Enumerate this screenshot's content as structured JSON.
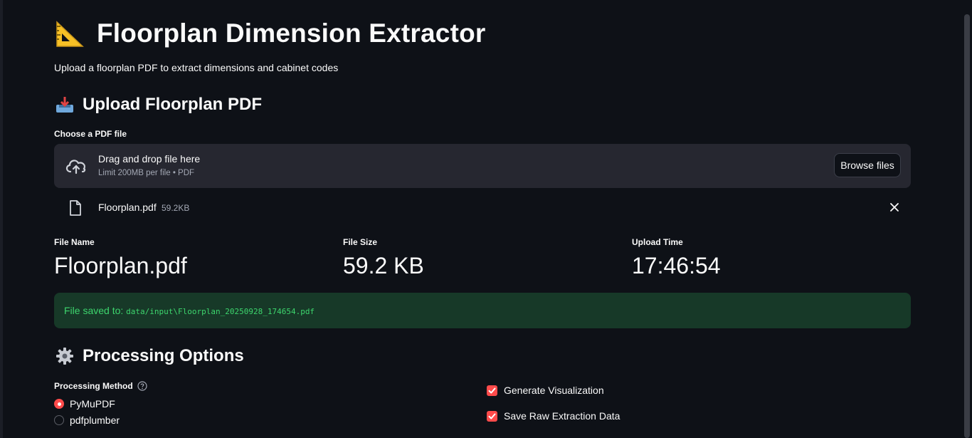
{
  "header": {
    "title_icon": "triangular-ruler-icon",
    "title": "Floorplan Dimension Extractor",
    "subtitle": "Upload a floorplan PDF to extract dimensions and cabinet codes"
  },
  "upload": {
    "section_icon": "inbox-tray-icon",
    "heading": "Upload Floorplan PDF",
    "field_label": "Choose a PDF file",
    "dropzone_title": "Drag and drop file here",
    "dropzone_limit": "Limit 200MB per file • PDF",
    "browse_label": "Browse files",
    "uploaded_file": {
      "name": "Floorplan.pdf",
      "size": "59.2KB"
    }
  },
  "metrics": [
    {
      "label": "File Name",
      "value": "Floorplan.pdf"
    },
    {
      "label": "File Size",
      "value": "59.2 KB"
    },
    {
      "label": "Upload Time",
      "value": "17:46:54"
    }
  ],
  "success": {
    "prefix": "File saved to:",
    "path": "data/input\\Floorplan_20250928_174654.pdf"
  },
  "processing": {
    "section_icon": "gear-icon",
    "heading": "Processing Options",
    "method_label": "Processing Method",
    "methods": [
      {
        "label": "PyMuPDF",
        "selected": true
      },
      {
        "label": "pdfplumber",
        "selected": false
      }
    ],
    "options": [
      {
        "label": "Generate Visualization",
        "checked": true
      },
      {
        "label": "Save Raw Extraction Data",
        "checked": true
      }
    ]
  },
  "colors": {
    "background": "#0e1117",
    "accent": "#ff4b4b",
    "success_bg": "#173928",
    "success_text": "#3dd56d",
    "surface": "#262730"
  }
}
